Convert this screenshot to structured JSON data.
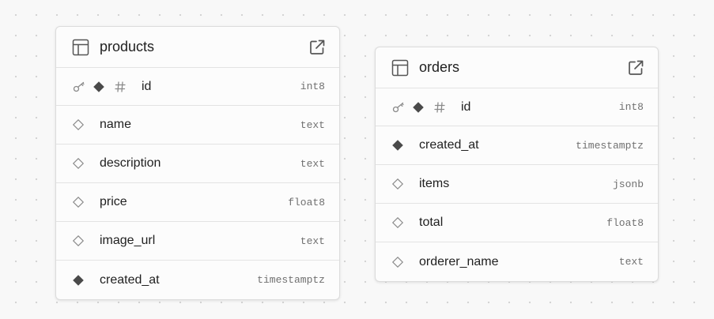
{
  "tables": [
    {
      "name": "products",
      "columns": [
        {
          "name": "id",
          "type": "int8",
          "primary_key": true,
          "nullable": false,
          "identity": true
        },
        {
          "name": "name",
          "type": "text",
          "nullable": true
        },
        {
          "name": "description",
          "type": "text",
          "nullable": true
        },
        {
          "name": "price",
          "type": "float8",
          "nullable": true
        },
        {
          "name": "image_url",
          "type": "text",
          "nullable": true
        },
        {
          "name": "created_at",
          "type": "timestamptz",
          "nullable": false
        }
      ]
    },
    {
      "name": "orders",
      "columns": [
        {
          "name": "id",
          "type": "int8",
          "primary_key": true,
          "nullable": false,
          "identity": true
        },
        {
          "name": "created_at",
          "type": "timestamptz",
          "nullable": false
        },
        {
          "name": "items",
          "type": "jsonb",
          "nullable": true
        },
        {
          "name": "total",
          "type": "float8",
          "nullable": true
        },
        {
          "name": "orderer_name",
          "type": "text",
          "nullable": true
        }
      ]
    }
  ],
  "icons": {
    "table": "table-icon",
    "open": "external-link-icon",
    "primary_key": "key-icon",
    "non_nullable": "filled-diamond-icon",
    "nullable": "hollow-diamond-icon",
    "identity": "hash-icon"
  },
  "colors": {
    "background": "#f8f8f8",
    "card": "#fcfcfc",
    "border": "#e3e3e3",
    "text": "#1f1f1f",
    "type_text": "#707070",
    "icon": "#4a4a4a",
    "muted_icon": "#8a8a8a"
  }
}
